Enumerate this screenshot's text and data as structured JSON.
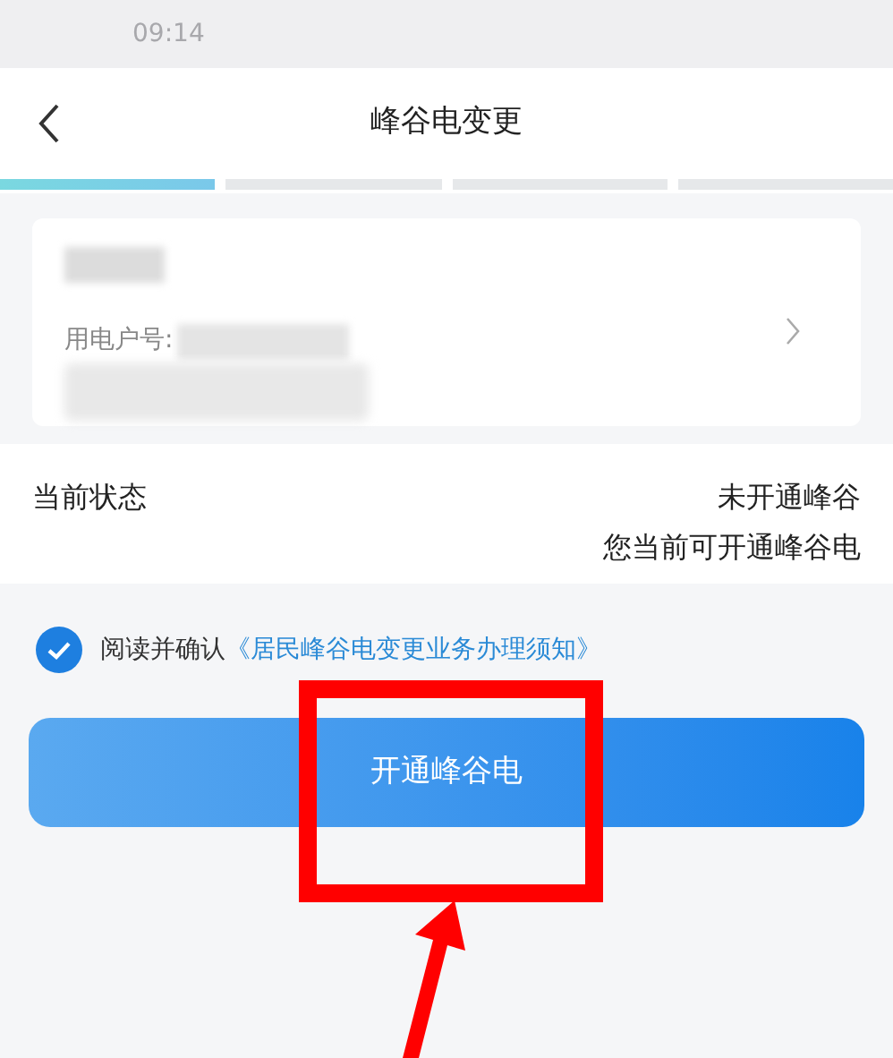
{
  "status_bar": {
    "time": "09:14"
  },
  "header": {
    "title": "峰谷电变更"
  },
  "steps": [
    {
      "selected": true
    },
    {
      "selected": false
    },
    {
      "selected": false
    },
    {
      "selected": false
    }
  ],
  "account_card": {
    "account_label": "用电户号:"
  },
  "status_section": {
    "label": "当前状态",
    "value": "未开通峰谷",
    "hint": "您当前可开通峰谷电"
  },
  "agreement": {
    "checked": true,
    "text": "阅读并确认",
    "link": "《居民峰谷电变更业务办理须知》"
  },
  "primary_button": {
    "label": "开通峰谷电"
  }
}
